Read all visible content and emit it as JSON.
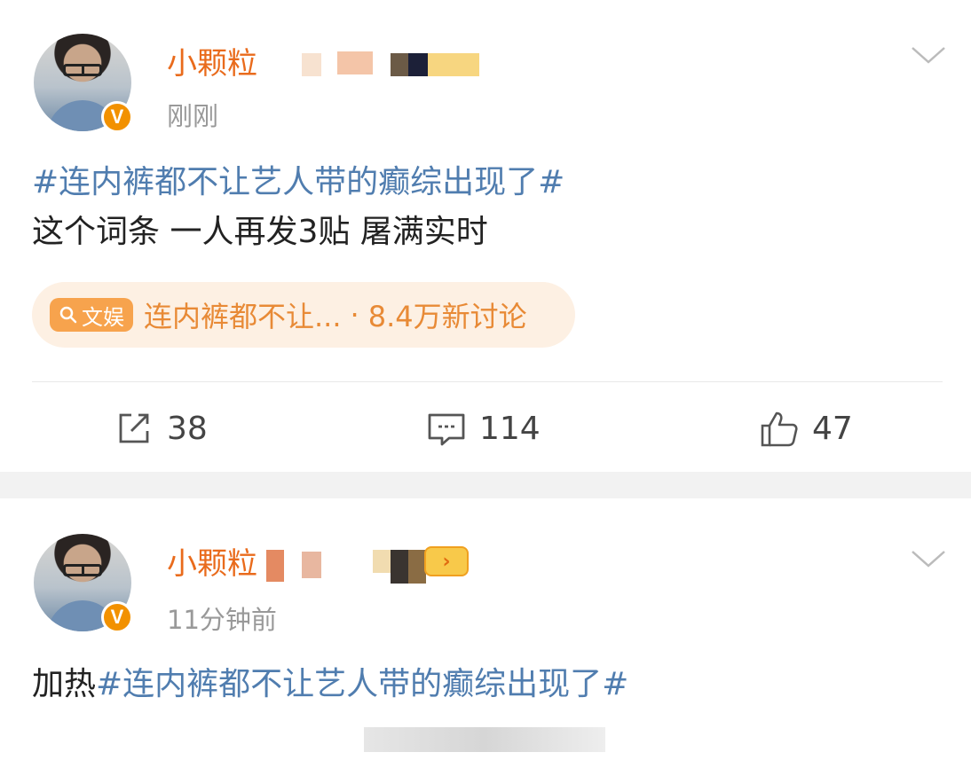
{
  "posts": [
    {
      "username": "小颗粒",
      "time": "刚刚",
      "hashtag": "#连内裤都不让艺人带的癫综出现了#",
      "body": "这个词条 一人再发3贴 屠满实时",
      "topic": {
        "badge_icon": "search-icon",
        "badge_label": "文娱",
        "title": "连内裤都不让...",
        "sep": "·",
        "count": "8.4万新讨论"
      },
      "actions": {
        "repost": "38",
        "comment": "114",
        "like": "47"
      }
    },
    {
      "username": "小颗粒",
      "time": "11分钟前",
      "prefix": "加热",
      "hashtag": "#连内裤都不让艺人带的癫综出现了#"
    }
  ],
  "colors": {
    "username": "#e96b1c",
    "hashtag": "#507daf",
    "verified": "#f29100",
    "topic_bg": "#fdf0e3"
  }
}
